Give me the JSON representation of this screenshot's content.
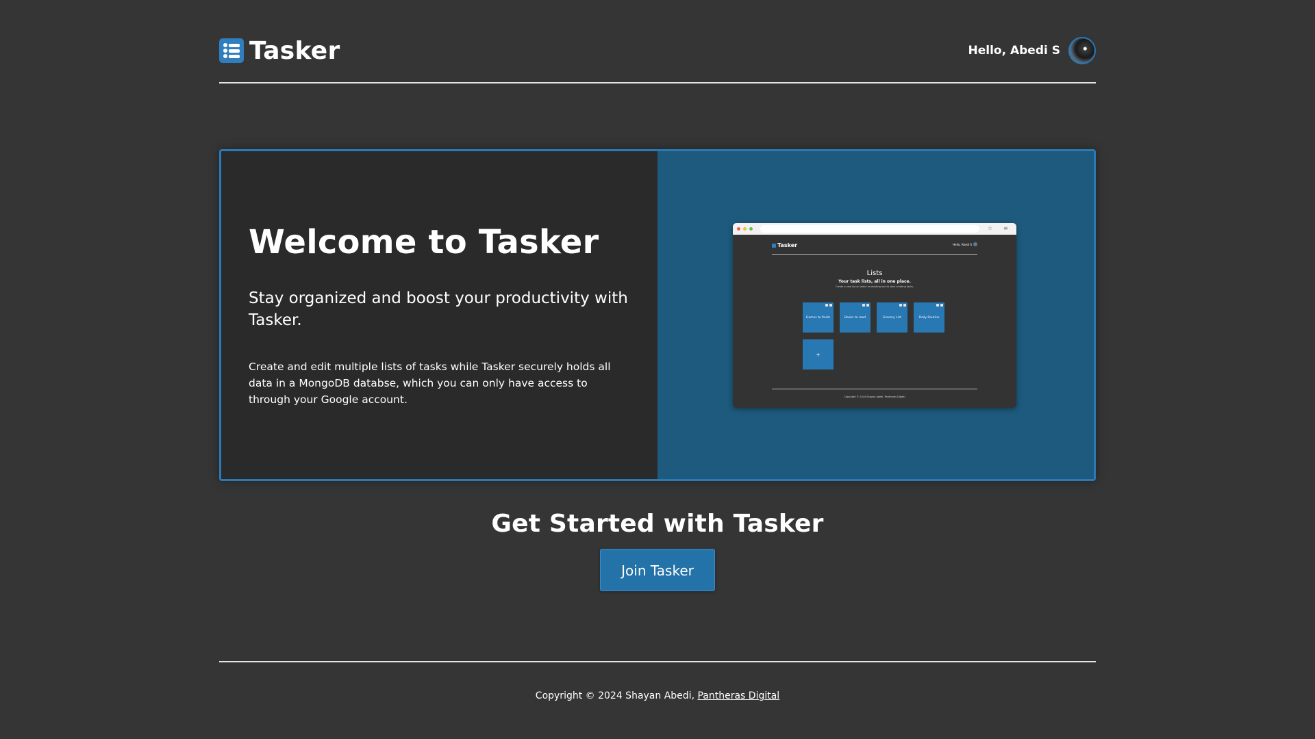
{
  "header": {
    "brand_title": "Tasker",
    "greeting": "Hello, Abedi S"
  },
  "hero": {
    "title": "Welcome to Tasker",
    "subtitle": "Stay organized and boost your productivity with Tasker.",
    "body": "Create and edit multiple lists of tasks while Tasker securely holds all data in a MongoDB databse, which you can only have access to through your Google account."
  },
  "preview": {
    "brand_title": "Tasker",
    "greeting": "Hello, Abedi S",
    "lists_title": "Lists",
    "lists_subtitle": "Your task lists, all in one place.",
    "lists_hint": "Create a new list or select an existing one to start creating tasks.",
    "cards": [
      "Games to finish",
      "Books to read",
      "Grocery List",
      "Daily Routine"
    ],
    "add_label": "+",
    "footer": "Copyright © 2024 Shayan Abedi, Pantheras Digital"
  },
  "cta": {
    "title": "Get Started with Tasker",
    "button_label": "Join Tasker"
  },
  "footer": {
    "copyright": "Copyright © 2024 Shayan Abedi, ",
    "link_label": "Pantheras Digital"
  },
  "colors": {
    "background": "#353535",
    "accent": "#2a7ab8",
    "hero_left": "#2a2a2a",
    "hero_right": "#1d5a7d",
    "button": "#2372a8"
  },
  "icons": {
    "brand": "list-icon",
    "avatar": "user-avatar"
  }
}
